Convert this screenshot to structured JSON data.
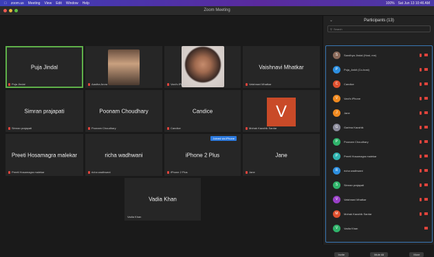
{
  "menubar": {
    "items": [
      "zoom.us",
      "Meeting",
      "View",
      "Edit",
      "Window",
      "Help"
    ],
    "status": [
      "100%",
      "Sat Jun 13 10:46 AM"
    ]
  },
  "window": {
    "title": "Zoom Meeting"
  },
  "gallery": {
    "tiles": [
      {
        "name": "Puja Jindal",
        "label": "Puja Jindal",
        "active": true
      },
      {
        "name": "",
        "label": "Aastha Arora",
        "video": "photo"
      },
      {
        "name": "",
        "label": "Vani's iPhone",
        "video": "webcam"
      },
      {
        "name": "Vaishnavi Mhatkar",
        "label": "Vaishnavi Mhatkar"
      },
      {
        "name": "Simran prajapati",
        "label": "Simran prajapati"
      },
      {
        "name": "Poonam Choudhary",
        "label": "Poonam Choudhary"
      },
      {
        "name": "Candice",
        "label": "Candice"
      },
      {
        "name": "",
        "label": "Mohak Kaushik Sardar",
        "avatar": "V"
      },
      {
        "name": "Preeti Hosamagra malekar",
        "label": "Preeti Hosamagra malekar"
      },
      {
        "name": "richa wadhwani",
        "label": "richa wadhwani"
      },
      {
        "name": "iPhone 2 Plus",
        "label": "iPhone 2 Plus",
        "badge": "Joined via iPhone"
      },
      {
        "name": "Jane",
        "label": "Jane"
      },
      {
        "name": "Vadia Khan",
        "label": "Vadia Khan"
      }
    ]
  },
  "panel": {
    "title": "Participants (13)",
    "search_placeholder": "Search",
    "participants": [
      {
        "name": "Sandhya Jindal (Host, me)",
        "initial": "S",
        "color": "#8a6a5a"
      },
      {
        "name": "Puja_Ankit (Co-host)",
        "initial": "P",
        "color": "#2d8fe0"
      },
      {
        "name": "Candice",
        "initial": "C",
        "color": "#e0502e"
      },
      {
        "name": "Vani's iPhone",
        "initial": "V",
        "color": "#f08a20"
      },
      {
        "name": "Jane",
        "initial": "J",
        "color": "#f08a20"
      },
      {
        "name": "Garima Kaushik",
        "initial": "G",
        "color": "#8a8a9a"
      },
      {
        "name": "Poonam Choudhary",
        "initial": "P",
        "color": "#2fb36a"
      },
      {
        "name": "Preeti Hosamagra malekar",
        "initial": "P",
        "color": "#2fb3b0"
      },
      {
        "name": "richa wadhwani",
        "initial": "R",
        "color": "#2d8fe0"
      },
      {
        "name": "Simran prajapati",
        "initial": "S",
        "color": "#2fb36a"
      },
      {
        "name": "Vaishnavi Mhatkar",
        "initial": "V",
        "color": "#9a40c8"
      },
      {
        "name": "Mohak Kaushik Sardar",
        "initial": "M",
        "color": "#e0502e"
      },
      {
        "name": "Vadia Khan",
        "initial": "V",
        "color": "#2fb36a"
      }
    ],
    "footer": {
      "invite": "Invite",
      "mute_all": "Mute All",
      "more": "More"
    }
  }
}
